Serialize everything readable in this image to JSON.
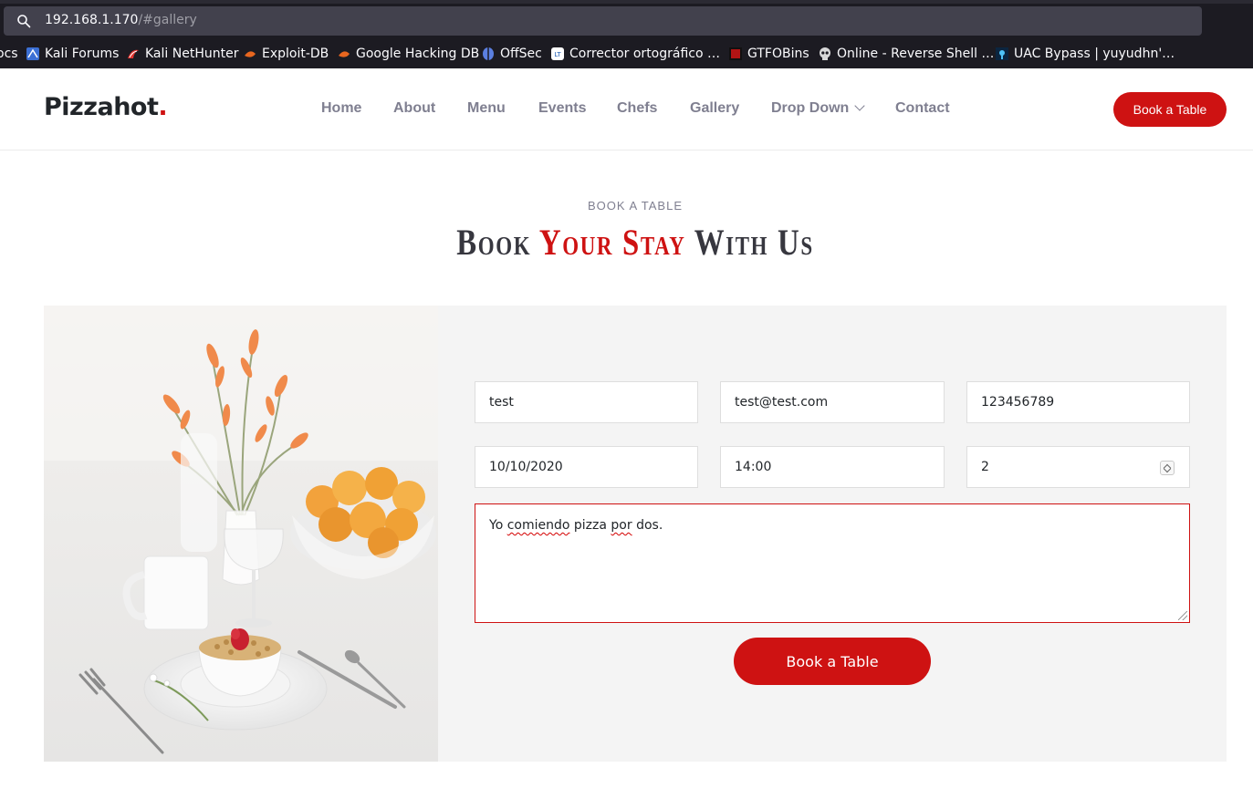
{
  "browser": {
    "url_host": "192.168.1.170",
    "url_path": "/#gallery",
    "bookmarks": [
      {
        "label": "ocs",
        "icon": "bookmark-icon"
      },
      {
        "label": "Kali Forums",
        "icon": "kali-forums-icon"
      },
      {
        "label": "Kali NetHunter",
        "icon": "kali-nethunter-icon"
      },
      {
        "label": "Exploit-DB",
        "icon": "exploit-db-icon"
      },
      {
        "label": "Google Hacking DB",
        "icon": "ghdb-icon"
      },
      {
        "label": "OffSec",
        "icon": "offsec-icon"
      },
      {
        "label": "Corrector ortográfico …",
        "icon": "corrector-icon"
      },
      {
        "label": "GTFOBins",
        "icon": "gtfobins-icon"
      },
      {
        "label": "Online - Reverse Shell …",
        "icon": "skull-icon"
      },
      {
        "label": "UAC Bypass | yuyudhn'…",
        "icon": "uac-bypass-icon"
      }
    ]
  },
  "header": {
    "logo_text": "Pizzahot",
    "logo_dot": ".",
    "nav": [
      {
        "label": "Home"
      },
      {
        "label": "About"
      },
      {
        "label": "Menu"
      },
      {
        "label": "Events"
      },
      {
        "label": "Chefs"
      },
      {
        "label": "Gallery"
      },
      {
        "label": "Drop Down"
      },
      {
        "label": "Contact"
      }
    ],
    "cta_label": "Book a Table"
  },
  "section": {
    "kicker": "BOOK A TABLE",
    "title_part1": "Book ",
    "title_accent": "Your Stay",
    "title_part2": " With Us"
  },
  "form": {
    "name": "test",
    "email": "test@test.com",
    "phone": "123456789",
    "date": "10/10/2020",
    "time": "14:00",
    "people": "2",
    "message_words": [
      "Yo",
      "comiendo",
      "pizza",
      "por",
      "dos."
    ],
    "submit_label": "Book a Table"
  },
  "colors": {
    "accent": "#ce1212",
    "nav_text": "#7f7f90",
    "panel_bg": "#f4f4f4",
    "browser_bg": "#1c1b22"
  }
}
